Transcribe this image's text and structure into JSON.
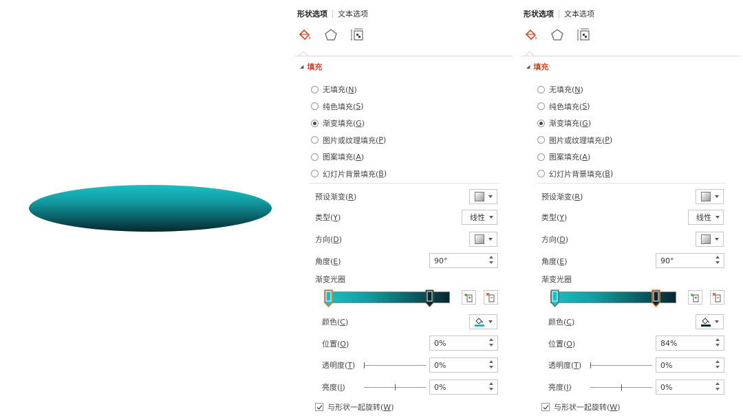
{
  "shape": {
    "gradient_colors": [
      "#18c0c4",
      "#129ca2",
      "#0b5f66",
      "#07282e"
    ]
  },
  "panels": [
    {
      "tabs": {
        "shape": "形状选项",
        "text": "文本选项"
      },
      "section_title": "填充",
      "fill_options": [
        {
          "label": "无填充(",
          "key": "N",
          "checked": false
        },
        {
          "label": "纯色填充(",
          "key": "S",
          "checked": false
        },
        {
          "label": "渐变填充(",
          "key": "G",
          "checked": true
        },
        {
          "label": "图片或纹理填充(",
          "key": "P",
          "checked": false
        },
        {
          "label": "图案填充(",
          "key": "A",
          "checked": false
        },
        {
          "label": "幻灯片背景填充(",
          "key": "B",
          "checked": false
        }
      ],
      "preset_label": "预设渐变(",
      "preset_key": "R",
      "type_label": "类型(",
      "type_key": "Y",
      "type_value": "线性",
      "direction_label": "方向(",
      "direction_key": "D",
      "angle_label": "角度(",
      "angle_key": "E",
      "angle_value": "90°",
      "gradient_stops_label": "渐变光圈",
      "selected_stop": "left",
      "color_label": "颜色(",
      "color_key": "C",
      "color_value": "#18b8bd",
      "position_label": "位置(",
      "position_key": "O",
      "position_value": "0%",
      "transparency_label": "透明度(",
      "transparency_key": "T",
      "transparency_value": "0%",
      "brightness_label": "亮度(",
      "brightness_key": "I",
      "brightness_value": "0%",
      "rotate_label": "与形状一起旋转(",
      "rotate_key": "W",
      "rotate_checked": true
    },
    {
      "tabs": {
        "shape": "形状选项",
        "text": "文本选项"
      },
      "section_title": "填充",
      "fill_options": [
        {
          "label": "无填充(",
          "key": "N",
          "checked": false
        },
        {
          "label": "纯色填充(",
          "key": "S",
          "checked": false
        },
        {
          "label": "渐变填充(",
          "key": "G",
          "checked": true
        },
        {
          "label": "图片或纹理填充(",
          "key": "P",
          "checked": false
        },
        {
          "label": "图案填充(",
          "key": "A",
          "checked": false
        },
        {
          "label": "幻灯片背景填充(",
          "key": "B",
          "checked": false
        }
      ],
      "preset_label": "预设渐变(",
      "preset_key": "R",
      "type_label": "类型(",
      "type_key": "Y",
      "type_value": "线性",
      "direction_label": "方向(",
      "direction_key": "D",
      "angle_label": "角度(",
      "angle_key": "E",
      "angle_value": "90°",
      "gradient_stops_label": "渐变光圈",
      "selected_stop": "right",
      "color_label": "颜色(",
      "color_key": "C",
      "color_value": "#07282e",
      "position_label": "位置(",
      "position_key": "O",
      "position_value": "84%",
      "transparency_label": "透明度(",
      "transparency_key": "T",
      "transparency_value": "0%",
      "brightness_label": "亮度(",
      "brightness_key": "I",
      "brightness_value": "0%",
      "rotate_label": "与形状一起旋转(",
      "rotate_key": "W",
      "rotate_checked": true
    }
  ],
  "accent_color": "#d24726",
  "stop_highlight_color": "#e07b39"
}
